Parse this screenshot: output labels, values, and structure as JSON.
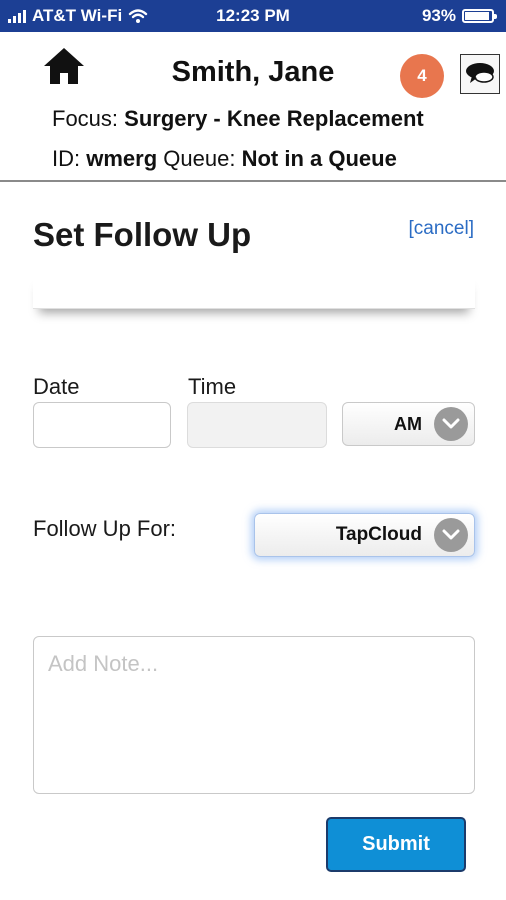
{
  "status_bar": {
    "carrier": "AT&T Wi-Fi",
    "time": "12:23 PM",
    "battery_text": "93%",
    "battery_level": 0.93
  },
  "header": {
    "patient_name": "Smith, Jane",
    "notification_count": "4",
    "focus_label": "Focus:",
    "focus_value": "Surgery - Knee Replacement",
    "id_label": "ID:",
    "id_value": "wmerg",
    "queue_label": "Queue:",
    "queue_value": "Not in a Queue",
    "icons": {
      "home": "home-icon",
      "chat": "chat-bubble-icon",
      "wifi": "wifi-icon"
    }
  },
  "form": {
    "title": "Set Follow Up",
    "cancel_label": "[cancel]",
    "date_label": "Date",
    "date_value": "",
    "time_label": "Time",
    "time_value": "",
    "ampm_value": "AM",
    "follow_up_label": "Follow Up For:",
    "follow_up_value": "TapCloud",
    "note_placeholder": "Add Note...",
    "note_value": "",
    "submit_label": "Submit"
  },
  "colors": {
    "status_bar_bg": "#1c3f94",
    "badge_bg": "#e8764e",
    "link": "#2b6cc4",
    "submit_bg": "#0f8fd6"
  }
}
